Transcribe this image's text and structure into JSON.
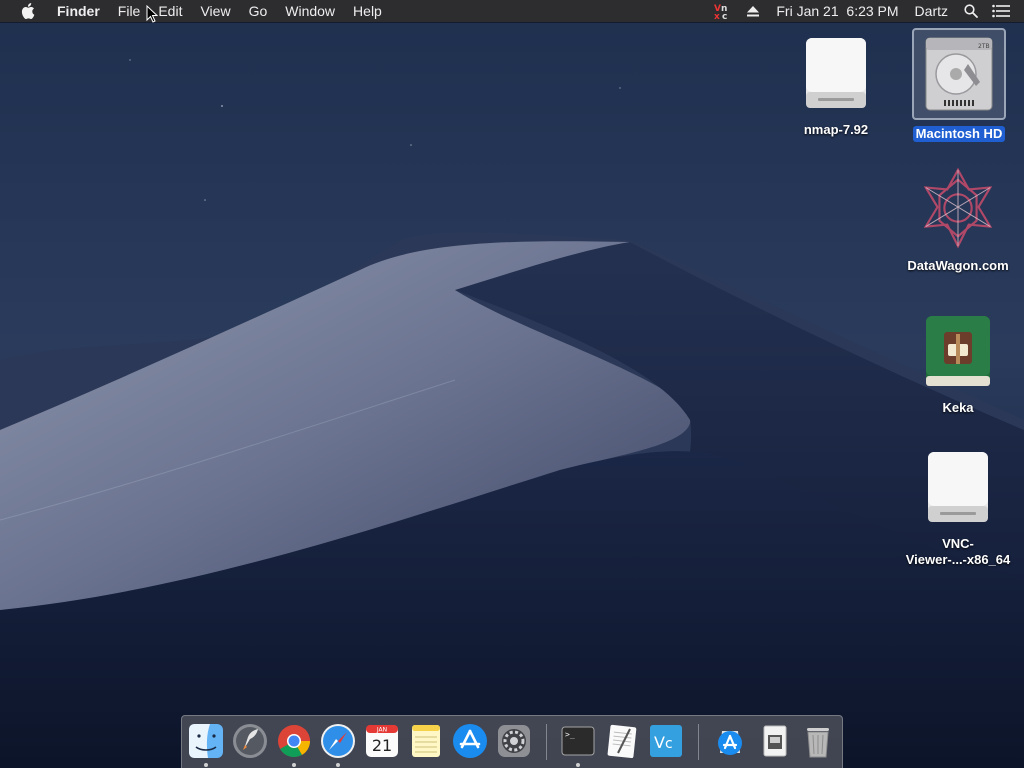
{
  "menubar": {
    "app_name": "Finder",
    "menus": [
      "File",
      "Edit",
      "View",
      "Go",
      "Window",
      "Help"
    ],
    "status": {
      "datetime": "Fri Jan 21  6:23 PM",
      "user": "Dartz"
    },
    "icons": [
      "apple-icon",
      "vnc-status-icon",
      "eject-icon",
      "spotlight-search-icon",
      "notification-center-icon"
    ]
  },
  "desktop": {
    "icons": [
      {
        "label": "nmap-7.92",
        "icon": "disk-image-icon",
        "selected": false
      },
      {
        "label": "Macintosh HD",
        "icon": "hard-drive-icon",
        "selected": true
      },
      {
        "label": "DataWagon.com",
        "icon": "datawagon-logo-icon",
        "selected": false
      },
      {
        "label": "Keka",
        "icon": "keka-app-icon",
        "selected": false
      },
      {
        "label": "VNC-\nViewer-...-x86_64",
        "label_line1": "VNC-",
        "label_line2": "Viewer-...-x86_64",
        "icon": "disk-image-icon",
        "selected": false
      }
    ]
  },
  "dock": {
    "calendar_month": "JAN",
    "calendar_day": "21",
    "apps": [
      {
        "name": "Finder",
        "icon": "finder-icon",
        "running": true
      },
      {
        "name": "Launchpad",
        "icon": "launchpad-icon",
        "running": false
      },
      {
        "name": "Google Chrome",
        "icon": "chrome-icon",
        "running": true
      },
      {
        "name": "Safari",
        "icon": "safari-icon",
        "running": true
      },
      {
        "name": "Calendar",
        "icon": "calendar-icon",
        "running": false
      },
      {
        "name": "Notes",
        "icon": "notes-icon",
        "running": false
      },
      {
        "name": "App Store",
        "icon": "app-store-icon",
        "running": false
      },
      {
        "name": "System Preferences",
        "icon": "system-preferences-icon",
        "running": false
      },
      {
        "name": "Terminal",
        "icon": "terminal-icon",
        "running": true
      },
      {
        "name": "TextEdit",
        "icon": "textedit-icon",
        "running": false
      },
      {
        "name": "VNC Viewer",
        "icon": "vnc-viewer-icon",
        "running": false
      },
      {
        "name": "Downloads",
        "icon": "downloads-folder-icon",
        "running": false
      },
      {
        "name": "Documents",
        "icon": "documents-stack-icon",
        "running": false
      },
      {
        "name": "Trash",
        "icon": "trash-icon",
        "running": false
      }
    ]
  },
  "colors": {
    "menubar_bg": "#2d2d30",
    "selection_blue": "#1f5fd1",
    "wallpaper_sky_top": "#1e2d4c",
    "wallpaper_sky_bottom": "#0f1a30"
  }
}
